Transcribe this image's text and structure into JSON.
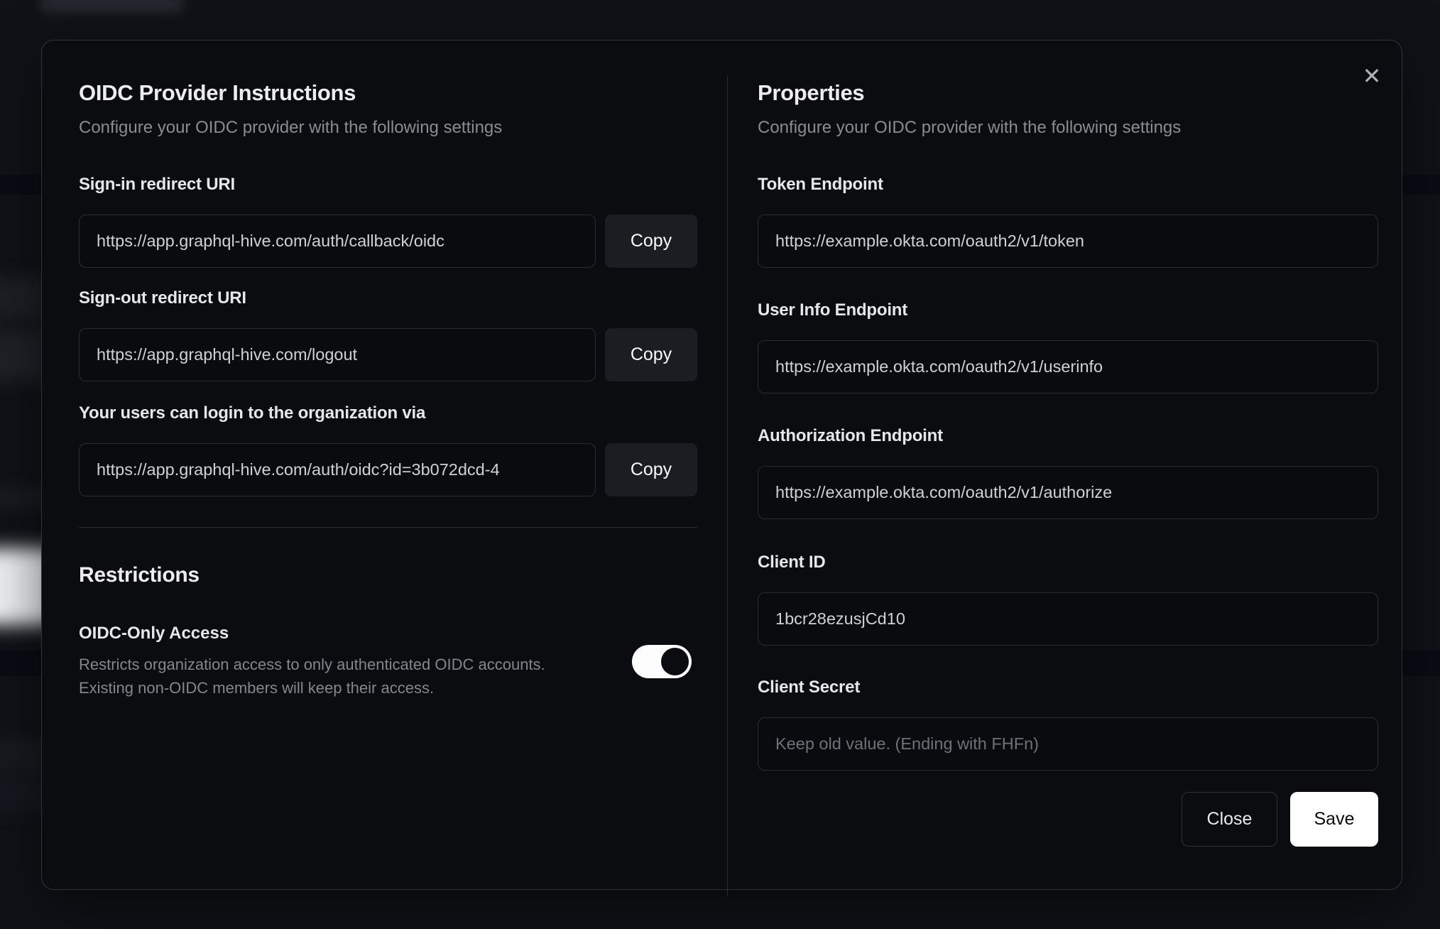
{
  "colors": {
    "backdrop": "#111218",
    "modal_bg": "#0b0c10",
    "modal_border": "#323338",
    "input_border": "#2b2c32",
    "copy_button_bg": "#1c1d22",
    "save_button_bg": "#ffffff",
    "toggle_track": "#fdfdfd",
    "toggle_knob": "#0b0c10",
    "heading_text": "#ededf0",
    "muted_text": "#8b8c92"
  },
  "modal": {
    "close_icon": "✕",
    "copy_label": "Copy",
    "left": {
      "title": "OIDC Provider Instructions",
      "subtitle": "Configure your OIDC provider with the following settings",
      "fields": [
        {
          "label": "Sign-in redirect URI",
          "value": "https://app.graphql-hive.com/auth/callback/oidc"
        },
        {
          "label": "Sign-out redirect URI",
          "value": "https://app.graphql-hive.com/logout"
        },
        {
          "label": "Your users can login to the organization via",
          "value": "https://app.graphql-hive.com/auth/oidc?id=3b072dcd-4"
        }
      ],
      "restrictions": {
        "title": "Restrictions",
        "toggle_label": "OIDC-Only Access",
        "description_line1": "Restricts organization access to only authenticated OIDC accounts.",
        "description_line2": "Existing non-OIDC members will keep their access.",
        "toggle_state": "on"
      }
    },
    "right": {
      "title": "Properties",
      "subtitle": "Configure your OIDC provider with the following settings",
      "fields": [
        {
          "label": "Token Endpoint",
          "value": "https://example.okta.com/oauth2/v1/token"
        },
        {
          "label": "User Info Endpoint",
          "value": "https://example.okta.com/oauth2/v1/userinfo"
        },
        {
          "label": "Authorization Endpoint",
          "value": "https://example.okta.com/oauth2/v1/authorize"
        },
        {
          "label": "Client ID",
          "value": "1bcr28ezusjCd10"
        },
        {
          "label": "Client Secret",
          "value": "",
          "placeholder": "Keep old value. (Ending with FHFn)"
        }
      ],
      "buttons": {
        "close": "Close",
        "save": "Save"
      }
    }
  }
}
